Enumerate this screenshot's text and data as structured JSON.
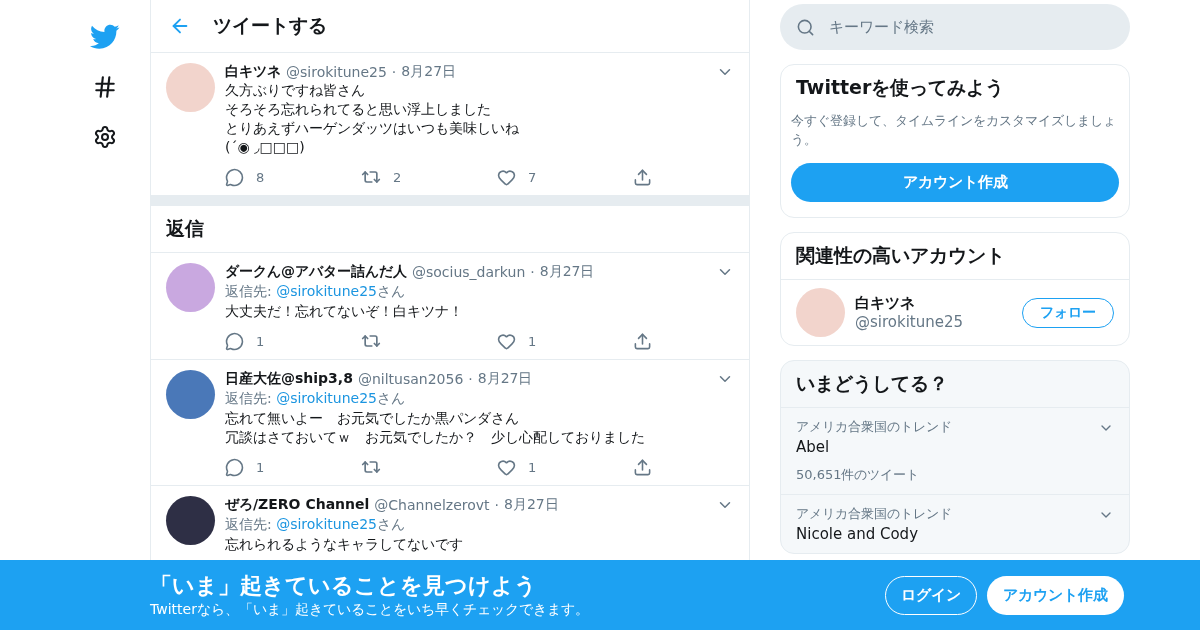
{
  "header": {
    "title": "ツイートする"
  },
  "main_tweet": {
    "author": "白キツネ",
    "handle": "@sirokitune25",
    "separator": "·",
    "date": "8月27日",
    "lines": [
      "久方ぶりですね皆さん",
      "そろそろ忘れられてると思い浮上しました",
      "とりあえずハーゲンダッツはいつも美味しいね",
      "(´◉ ◞□□□)"
    ],
    "replies": "8",
    "retweets": "2",
    "likes": "7"
  },
  "replies_heading": "返信",
  "replies": [
    {
      "author": "ダークん@アバター詰んだ人",
      "handle": "@socius_darkun",
      "separator": "·",
      "date": "8月27日",
      "reply_label": "返信先:",
      "reply_to": "@sirokitune25",
      "reply_suffix": "さん",
      "lines": [
        "大丈夫だ！忘れてないぞ！白キツナ！"
      ],
      "replies": "1",
      "likes": "1"
    },
    {
      "author": "日産大佐@ship3,8",
      "handle": "@niltusan2056",
      "separator": "·",
      "date": "8月27日",
      "reply_label": "返信先:",
      "reply_to": "@sirokitune25",
      "reply_suffix": "さん",
      "lines": [
        "忘れて無いよー　お元気でしたか黒パンダさん",
        "冗談はさておいてｗ　お元気でしたか？　少し心配しておりました"
      ],
      "replies": "1",
      "likes": "1"
    },
    {
      "author": "ぜろ/ZERO Channel",
      "handle": "@Channelzerovt",
      "separator": "·",
      "date": "8月27日",
      "reply_label": "返信先:",
      "reply_to": "@sirokitune25",
      "reply_suffix": "さん",
      "lines": [
        "忘れられるようなキャラしてないです"
      ]
    }
  ],
  "search": {
    "placeholder": "キーワード検索"
  },
  "signup_card": {
    "title": "Twitterを使ってみよう",
    "text": "今すぐ登録して、タイムラインをカスタマイズしましょう。",
    "button": "アカウント作成"
  },
  "related_card": {
    "title": "関連性の高いアカウント",
    "accounts": [
      {
        "name": "白キツネ",
        "handle": "@sirokitune25",
        "button": "フォロー"
      }
    ]
  },
  "trends_card": {
    "title": "いまどうしてる？",
    "trends": [
      {
        "context": "アメリカ合衆国のトレンド",
        "name": "Abel",
        "count": "50,651件のツイート"
      },
      {
        "context": "アメリカ合衆国のトレンド",
        "name": "Nicole and Cody"
      }
    ]
  },
  "banner": {
    "title": "「いま」起きていることを見つけよう",
    "text": "Twitterなら、「いま」起きていることをいち早くチェックできます。",
    "login": "ログイン",
    "signup": "アカウント作成"
  }
}
